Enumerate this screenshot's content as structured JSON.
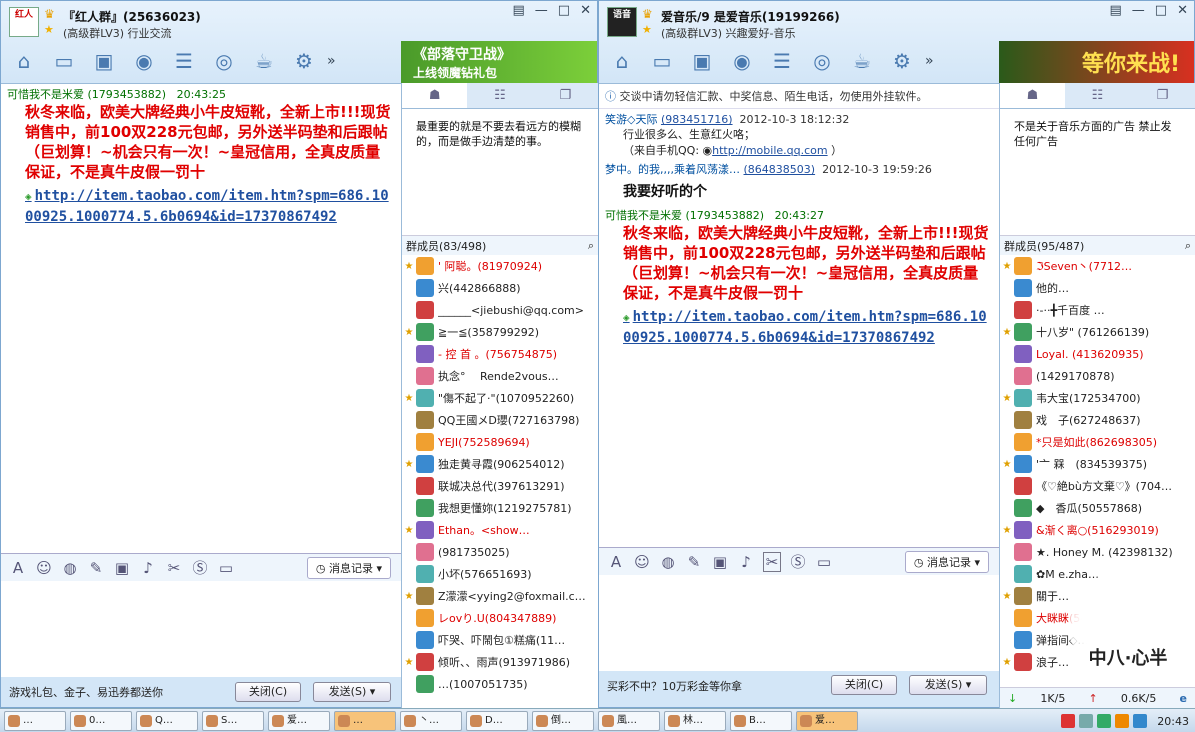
{
  "w1": {
    "avatar": "红人",
    "title": "『红人群』(25636023)",
    "subtitle": "(高级群LV3) 行业交流",
    "ad_line1": "《部落守卫战》",
    "ad_line2": "上线领魔钻礼包",
    "sender": "可惜我不是米爱 (1793453882)",
    "time": "20:43:25",
    "message": "秋冬来临，欧美大牌经典小牛皮短靴，全新上市!!!现货销售中，前100双228元包邮，另外送半码垫和后跟帖（巨划算！~机会只有一次！~皇冠信用，全真皮质量保证，不是真牛皮假一罚十",
    "link": "http://item.taobao.com/item.htm?spm=686.1000925.1000774.5.6b0694&id=17370867492",
    "history": "消息记录",
    "footer": "游戏礼包、金子、易迅券都送你",
    "close": "关闭(C)",
    "send": "发送(S)",
    "announcement": "最重要的就是不要去看远方的模糊的，而是做手边清楚的事。",
    "members_header": "群成员(83/498)",
    "members": [
      "' 阿聪。(81970924)",
      "兴(442866888)",
      "______<jiebushi@qq.com>",
      "≧一≦(358799292)",
      "- 控 首 。(756754875)",
      "执念° 　Rende2vous…",
      "\"傷不起了·\"(1070952260)",
      "QQ王國メD瓔(727163798)",
      "YEJI(752589694)",
      "独走黄寻霞(906254012)",
      "联城决总代(397613291)",
      "我想更懂妳(1219275781)",
      "Ethan。<show…",
      "(981735025)",
      "小坏(576651693)",
      "Z濛濛<yying2@foxmail.c…",
      "レovり.U(804347889)",
      "吓哭、吓鬧包①糕痛(11…",
      "倾听、、雨声(913971986)",
      "…(1007051735)"
    ]
  },
  "w2": {
    "avatar": "语音",
    "title": "爱音乐/9 是爱音乐(19199266)",
    "subtitle": "(高级群LV3) 兴趣爱好-音乐",
    "ad": "等你来战!",
    "notice": "交谈中请勿轻信汇款、中奖信息、陌生电话，勿使用外挂软件。",
    "m1_sender": "笑游◇天际",
    "m1_id": "(983451716)",
    "m1_time": "2012-10-3 18:12:32",
    "m1_line1": "行业很多么、生意红火咯；",
    "m1_line2": "（来自手机QQ:",
    "m1_link": "http://mobile.qq.com",
    "m1_end": "）",
    "m2_sender": "梦中。的我,,,,乘着风荡漾…",
    "m2_id": "(864838503)",
    "m2_time": "2012-10-3 19:59:26",
    "m2_text": "我要好听的个",
    "m3_sender": "可惜我不是米爱 (1793453882)",
    "m3_time": "20:43:27",
    "message": "秋冬来临，欧美大牌经典小牛皮短靴，全新上市!!!现货销售中，前100双228元包邮，另外送半码垫和后跟帖（巨划算！~机会只有一次！~皇冠信用，全真皮质量保证，不是真牛皮假一罚十",
    "link": "http://item.taobao.com/item.htm?spm=686.1000925.1000774.5.6b0694&id=17370867492",
    "history": "消息记录",
    "footer": "买彩不中？10万彩金等你拿",
    "close": "关闭(C)",
    "send": "发送(S)",
    "announcement": "不是关于音乐方面的广告 禁止发任何广告",
    "members_header": "群成员(95/487)",
    "members": [
      "ℑSeven丶(7712…",
      "他的…",
      "·-··╋千百度 …",
      "十八岁\" (761266139)",
      "Loyal. (413620935)",
      "(1429170878)",
      "韦大宝(172534700)",
      "戏　子(627248637)",
      "*只是如此(862698305)",
      "'亠 槑　(834539375)",
      "《♡絶bù方文棄♡》(704…",
      "◆　香瓜(50557868)",
      "&渐く离○(516293019)",
      "★. Honey M. (42398132)",
      "✿M e.zha…",
      "關于…",
      "大眯眯(5427…",
      "弹指间◇…",
      "浪子…"
    ],
    "speed_down": "1K/5",
    "speed_up": "0.6K/5"
  },
  "taskbar": {
    "items": [
      "…",
      "0…",
      "Q…",
      "S…",
      "爱…",
      "…",
      "丶…",
      "D…",
      "倒…",
      "風…",
      "林…",
      "B…",
      "爱…"
    ],
    "clock": "20:43",
    "mascot": "中八·心半"
  }
}
